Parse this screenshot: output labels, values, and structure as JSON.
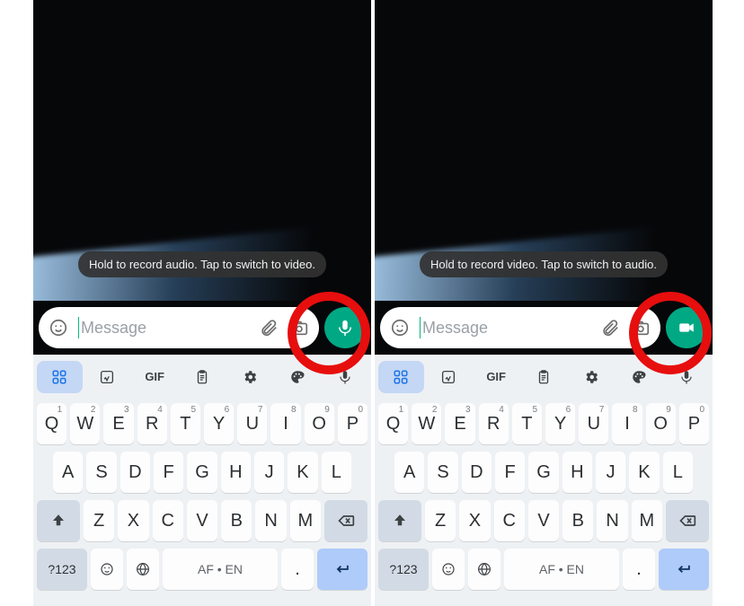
{
  "left": {
    "tooltip": "Hold to record audio. Tap to switch to video.",
    "input_placeholder": "Message",
    "fab_mode": "audio"
  },
  "right": {
    "tooltip": "Hold to record video. Tap to switch to audio.",
    "input_placeholder": "Message",
    "fab_mode": "video"
  },
  "keyboard": {
    "toolbar": {
      "gif_label": "GIF"
    },
    "row1": [
      {
        "k": "Q",
        "s": "1"
      },
      {
        "k": "W",
        "s": "2"
      },
      {
        "k": "E",
        "s": "3"
      },
      {
        "k": "R",
        "s": "4"
      },
      {
        "k": "T",
        "s": "5"
      },
      {
        "k": "Y",
        "s": "6"
      },
      {
        "k": "U",
        "s": "7"
      },
      {
        "k": "I",
        "s": "8"
      },
      {
        "k": "O",
        "s": "9"
      },
      {
        "k": "P",
        "s": "0"
      }
    ],
    "row2": [
      "A",
      "S",
      "D",
      "F",
      "G",
      "H",
      "J",
      "K",
      "L"
    ],
    "row3": [
      "Z",
      "X",
      "C",
      "V",
      "B",
      "N",
      "M"
    ],
    "bottom": {
      "sym": "?123",
      "space": "AF • EN",
      "period": "."
    }
  }
}
